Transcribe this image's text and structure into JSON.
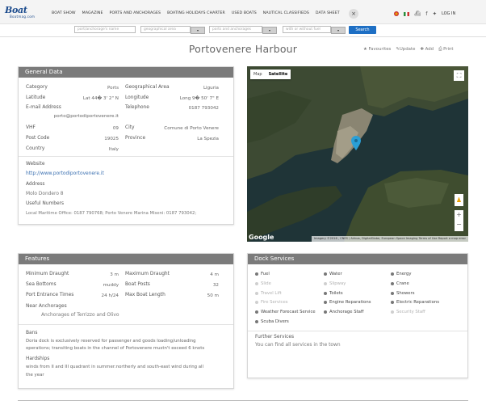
{
  "nav": {
    "logo_top": "Boat",
    "logo_bottom": "Boatmag.com",
    "menu": [
      "BOAT SHOW",
      "MAGAZINE",
      "PORTS AND ANCHORAGES",
      "BOATING HOLIDAYS CHARTER",
      "USED BOATS",
      "NAUTICAL CLASSIFIEDS",
      "DATA SHEET"
    ],
    "close": "×",
    "login": "LOG IN"
  },
  "search": {
    "name_placeholder": "port/anchorage's name",
    "area_placeholder": "geographical area",
    "type_placeholder": "ports and anchorages",
    "fuel_placeholder": "with or without fuel",
    "button": "Search"
  },
  "title": "Portovenere Harbour",
  "actions": {
    "favourites": "Favourites",
    "update": "Update",
    "add": "Add",
    "print": "Print"
  },
  "general": {
    "heading": "General Data",
    "category_label": "Category",
    "category": "Ports",
    "latitude_label": "Latitude",
    "latitude": "Lat 44� 3' 2\" N",
    "email_label": "E-mail Address",
    "email": "porto@portodiportovenere.it",
    "vhf_label": "VHF",
    "vhf": "09",
    "postcode_label": "Post Code",
    "postcode": "19025",
    "country_label": "Country",
    "country": "Italy",
    "area_label": "Geographical Area",
    "area": "Liguria",
    "longitude_label": "Longitude",
    "longitude": "Long 9� 50' 7\" E",
    "telephone_label": "Telephone",
    "telephone": "0187 793042",
    "city_label": "City",
    "city": "Comune di Porto Venere",
    "province_label": "Province",
    "province": "La Spezia",
    "website_label": "Website",
    "website": "http://www.portodiportovenere.it",
    "address_label": "Address",
    "address": "Molo Dondero 8",
    "useful_label": "Useful Numbers",
    "useful": "Local Maritime Office: 0187 790768; Porto Venere Marina Miseni: 0187 793042;"
  },
  "map": {
    "tab_map": "Map",
    "tab_satellite": "Satellite",
    "google": "Google",
    "footer": "Imagery ©2016 , CNES / Airbus, DigitalGlobe, European Space Imaging   Terms of Use   Report a map error"
  },
  "features": {
    "heading": "Features",
    "min_draught_label": "Minimum Draught",
    "min_draught": "3 m",
    "sea_bottoms_label": "Sea Bottoms",
    "sea_bottoms": "muddy",
    "entrance_label": "Port Entrance Times",
    "entrance": "24 h/24",
    "max_draught_label": "Maximum Draught",
    "max_draught": "4 m",
    "boat_posts_label": "Boat Posts",
    "boat_posts": "32",
    "max_length_label": "Max Boat Length",
    "max_length": "50 m",
    "near_label": "Near Anchorages",
    "near": "Anchorages of Terrizzo and Olivo",
    "bans_label": "Bans",
    "bans_1": "Doria dock is exclusively reserved for passenger and goods loading/unloading",
    "bans_2": "operations; transiting boats in the channel of Portovenere mustn't exceed 6 knots",
    "hardships_label": "Hardships",
    "hardships_1": "winds from II and III quadrant in summer:northerly and south-east wind during all",
    "hardships_2": "the year"
  },
  "dock": {
    "heading": "Dock Services",
    "services": [
      {
        "label": "Fuel",
        "on": true
      },
      {
        "label": "Water",
        "on": true
      },
      {
        "label": "Energy",
        "on": true
      },
      {
        "label": "Slide",
        "on": false
      },
      {
        "label": "Slipway",
        "on": false
      },
      {
        "label": "Crane",
        "on": true
      },
      {
        "label": "Travel Lift",
        "on": false
      },
      {
        "label": "Toilets",
        "on": true
      },
      {
        "label": "Showers",
        "on": true
      },
      {
        "label": "Fire Services",
        "on": false
      },
      {
        "label": "Engine Reparations",
        "on": true
      },
      {
        "label": "Electric Reparations",
        "on": true
      },
      {
        "label": "Weather Forecast Service",
        "on": true
      },
      {
        "label": "Anchorage Staff",
        "on": true
      },
      {
        "label": "Security Staff",
        "on": false
      },
      {
        "label": "Scuba Divers",
        "on": true
      }
    ],
    "further_label": "Further Services",
    "further": "You can find all services in the town"
  },
  "colors": {
    "search_button": "#1e6fc4",
    "panel_header": "#7b7b7b",
    "link": "#3a6fb0",
    "map_pin": "#2a9fd6"
  }
}
